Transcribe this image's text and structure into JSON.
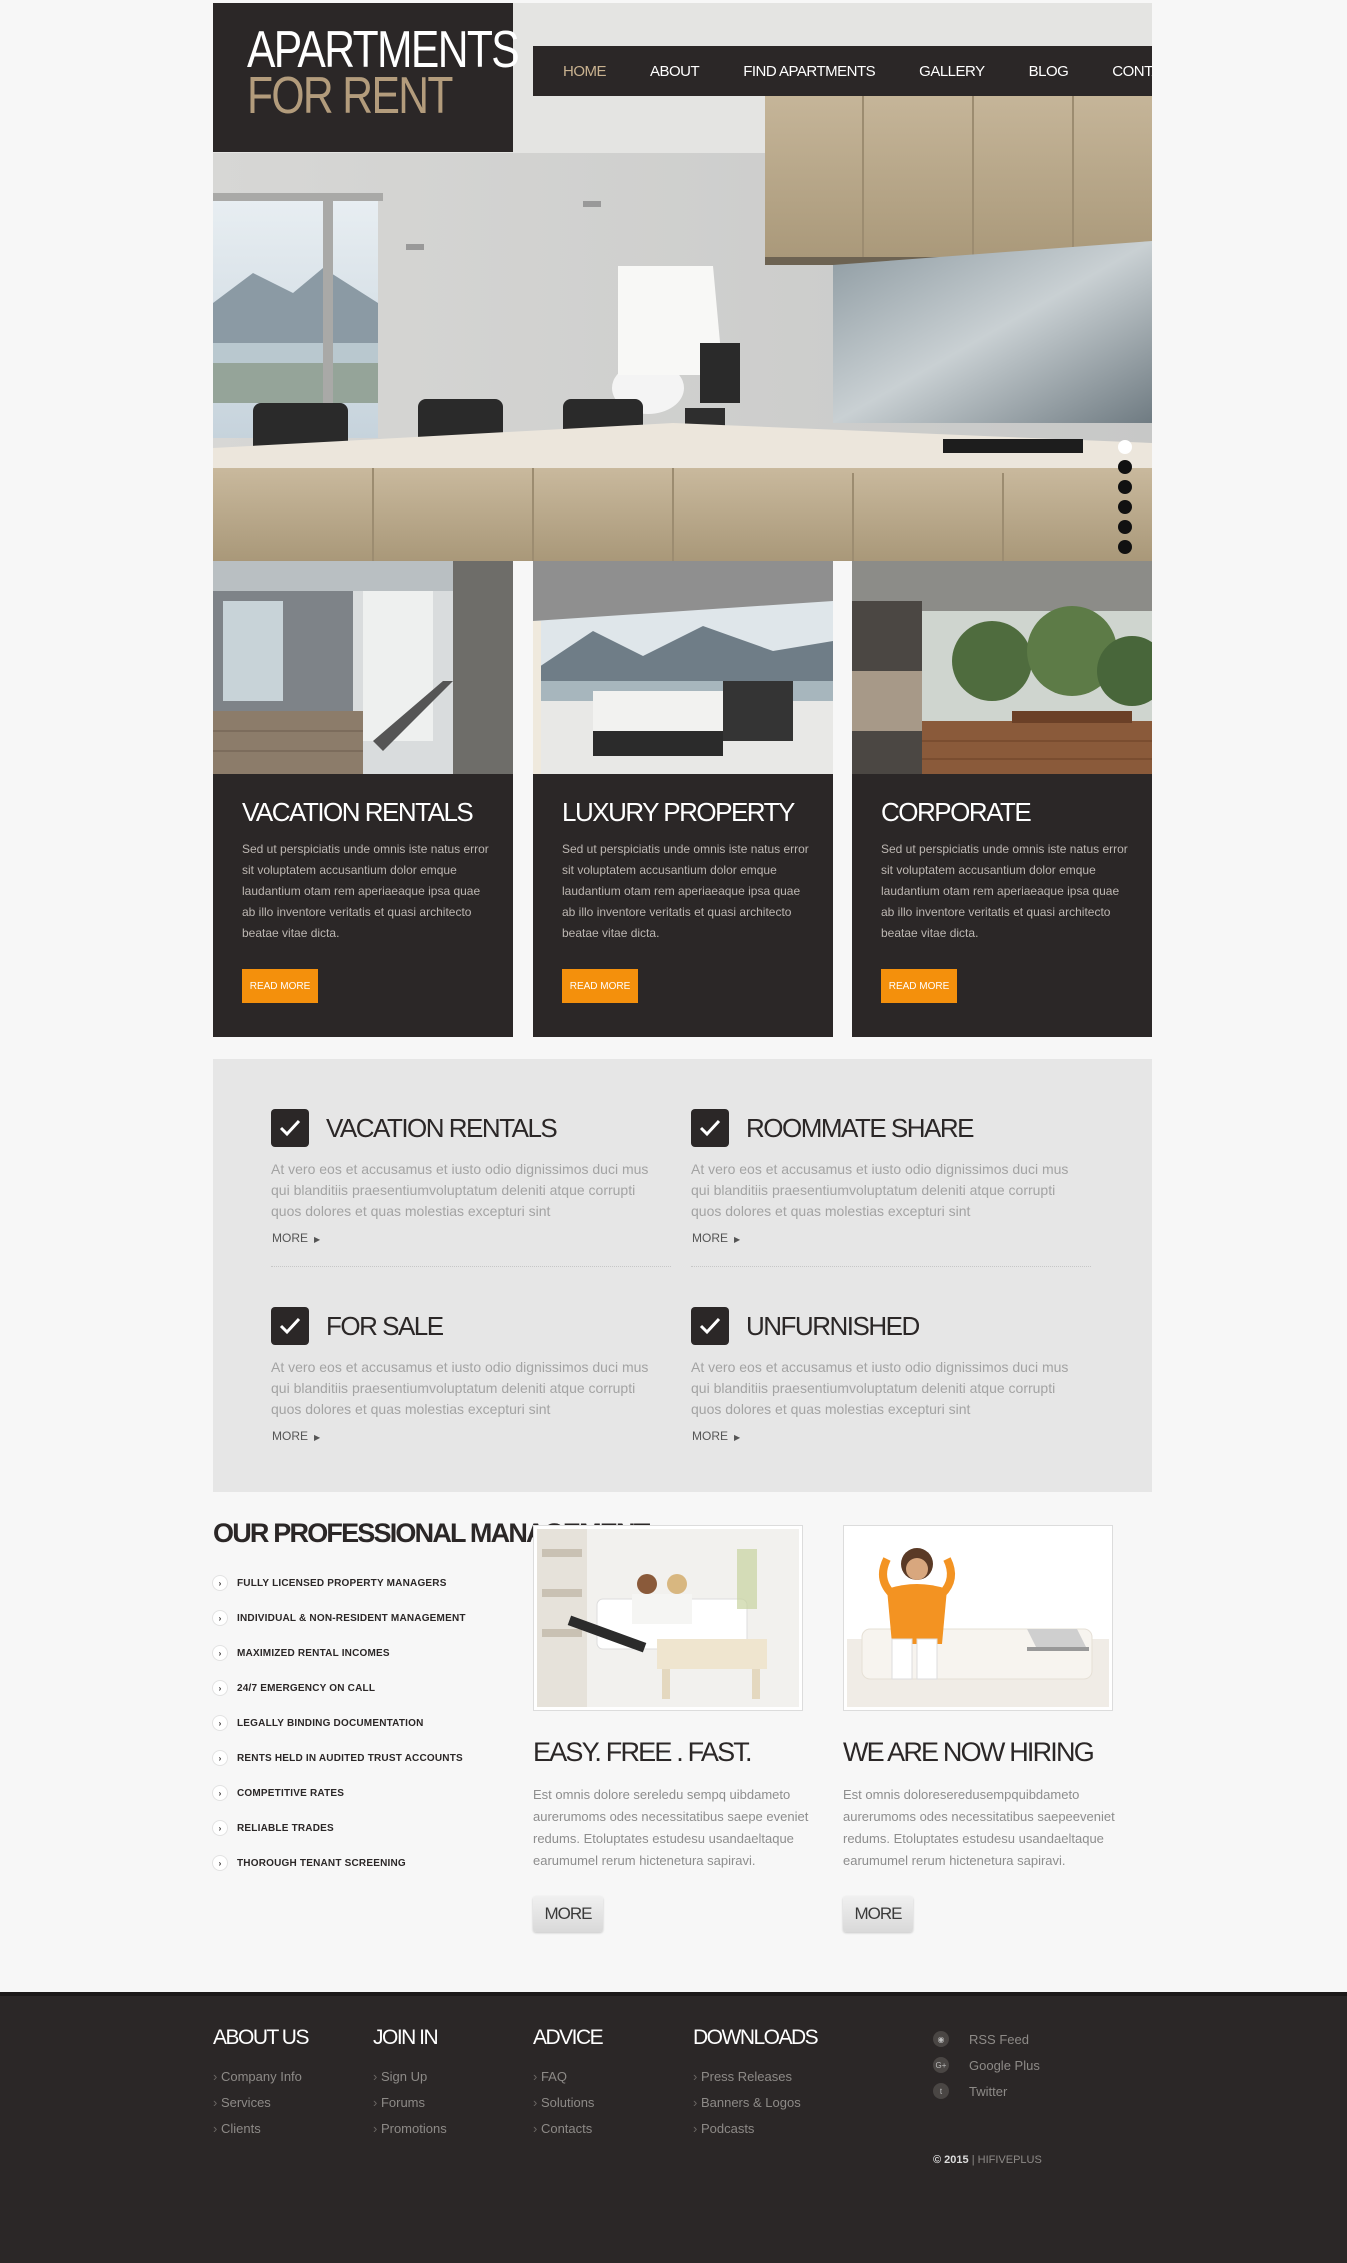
{
  "brand": {
    "line1": "APARTMENTS",
    "line2": "FOR RENT"
  },
  "nav": [
    {
      "label": "HOME",
      "active": true
    },
    {
      "label": "ABOUT"
    },
    {
      "label": "FIND APARTMENTS"
    },
    {
      "label": "GALLERY"
    },
    {
      "label": "BLOG"
    },
    {
      "label": "CONTACTS"
    }
  ],
  "slider": {
    "dots": 6,
    "active_index": 0
  },
  "cards": [
    {
      "title": "VACATION RENTALS",
      "text": "Sed ut perspiciatis unde omnis iste natus error sit voluptatem accusantium dolor emque laudantium otam rem aperiaeaque ipsa quae ab illo inventore veritatis et quasi architecto beatae vitae dicta.",
      "button": "READ MORE"
    },
    {
      "title": "LUXURY PROPERTY",
      "text": "Sed ut perspiciatis unde omnis iste natus error sit voluptatem accusantium dolor emque laudantium otam rem aperiaeaque ipsa quae ab illo inventore veritatis et quasi architecto beatae vitae dicta.",
      "button": "READ MORE"
    },
    {
      "title": "CORPORATE",
      "text": "Sed ut perspiciatis unde omnis iste natus error sit voluptatem accusantium dolor emque laudantium otam rem aperiaeaque ipsa quae ab illo inventore veritatis et quasi architecto beatae vitae dicta.",
      "button": "READ MORE"
    }
  ],
  "features": [
    {
      "title": "VACATION RENTALS",
      "text": "At vero eos et accusamus et iusto odio dignissimos duci mus qui blanditiis praesentiumvoluptatum deleniti atque corrupti quos dolores et quas molestias excepturi sint",
      "more": "MORE"
    },
    {
      "title": "ROOMMATE SHARE",
      "text": "At vero eos et accusamus et iusto odio dignissimos duci mus qui blanditiis praesentiumvoluptatum deleniti atque corrupti quos dolores et quas molestias excepturi sint",
      "more": "MORE"
    },
    {
      "title": "FOR SALE",
      "text": "At vero eos et accusamus et iusto odio dignissimos duci mus qui blanditiis praesentiumvoluptatum deleniti atque corrupti quos dolores et quas molestias excepturi sint",
      "more": "MORE"
    },
    {
      "title": "UNFURNISHED",
      "text": "At vero eos et accusamus et iusto odio dignissimos duci mus qui blanditiis praesentiumvoluptatum deleniti atque corrupti quos dolores et quas molestias excepturi sint",
      "more": "MORE"
    }
  ],
  "management": {
    "title": "OUR PROFESSIONAL MANAGEMENT",
    "items": [
      "FULLY LICENSED PROPERTY MANAGERS",
      "INDIVIDUAL & NON-RESIDENT MANAGEMENT",
      "MAXIMIZED RENTAL INCOMES",
      "24/7 EMERGENCY ON CALL",
      "LEGALLY BINDING DOCUMENTATION",
      "RENTS HELD IN AUDITED TRUST ACCOUNTS",
      "COMPETITIVE RATES",
      "RELIABLE TRADES",
      "THOROUGH TENANT SCREENING"
    ]
  },
  "promos": [
    {
      "title": "EASY. FREE . FAST.",
      "text": "Est omnis dolore sereledu sempq uibdameto aurerumoms odes necessitatibus saepe eveniet redums. Etoluptates estudesu usandaeltaque earumumel rerum hictenetura sapiravi.",
      "button": "MORE"
    },
    {
      "title": "WE ARE NOW HIRING",
      "text": "Est omnis doloreseredusempquibdameto aurerumoms odes necessitatibus saepeeveniet redums. Etoluptates estudesu usandaeltaque earumumel rerum hictenetura sapiravi.",
      "button": "MORE"
    }
  ],
  "footer": {
    "columns": [
      {
        "title": "ABOUT US",
        "links": [
          "Company Info",
          "Services",
          "Clients"
        ]
      },
      {
        "title": "JOIN IN",
        "links": [
          "Sign Up",
          "Forums",
          "Promotions"
        ]
      },
      {
        "title": "ADVICE",
        "links": [
          "FAQ",
          "Solutions",
          "Contacts"
        ]
      },
      {
        "title": "DOWNLOADS",
        "links": [
          "Press Releases",
          "Banners & Logos",
          "Podcasts"
        ]
      }
    ],
    "social": [
      {
        "icon": "rss-icon",
        "glyph": "◉",
        "label": "RSS Feed"
      },
      {
        "icon": "google-plus-icon",
        "glyph": "G+",
        "label": "Google Plus"
      },
      {
        "icon": "twitter-icon",
        "glyph": "t",
        "label": "Twitter"
      }
    ],
    "copyright_year": "© 2015",
    "copyright_sep": " | ",
    "copyright_name": "HIFIVEPLUS"
  },
  "colors": {
    "dark": "#2b2727",
    "accent": "#f4900c",
    "gold": "#b39c7c",
    "panel": "#e6e6e6"
  }
}
